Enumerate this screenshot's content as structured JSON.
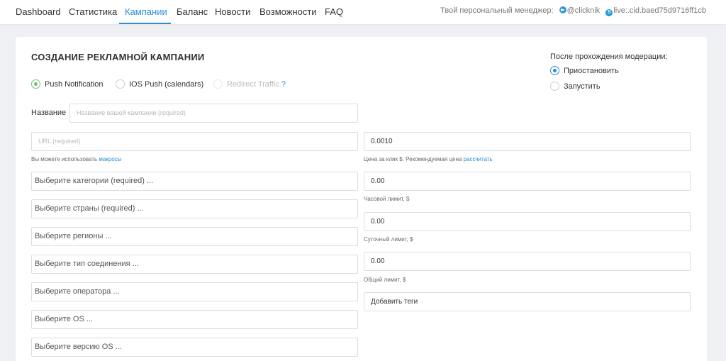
{
  "nav": {
    "items": [
      "Dashboard",
      "Статистика",
      "Кампании",
      "Баланс",
      "Новости",
      "Возможности",
      "FAQ"
    ],
    "active_index": 2,
    "manager_label": "Твой персональный менеджер:",
    "telegram": "@clicknik",
    "skype": "live:.cid.baed75d9716ff1cb"
  },
  "form": {
    "title": "СОЗДАНИЕ РЕКЛАМНОЙ КАМПАНИИ",
    "types": [
      {
        "label": "Push Notification",
        "checked": true,
        "disabled": false
      },
      {
        "label": "IOS Push (calendars)",
        "checked": false,
        "disabled": false
      },
      {
        "label": "Redirect Traffic",
        "checked": false,
        "disabled": true,
        "suffix": "?"
      }
    ],
    "moderation": {
      "title": "После прохождения модерации:",
      "options": [
        {
          "label": "Приостановить",
          "checked": true
        },
        {
          "label": "Запустить",
          "checked": false
        }
      ]
    },
    "name_label": "Название",
    "name_placeholder": "Название вашей кампании (required)",
    "url_placeholder": "URL  (required)",
    "url_help": "Вы можете использовать",
    "url_help_link": "макросы",
    "selects": [
      "Выберите категории (required) ...",
      "Выберите страны (required) ...",
      "Выберите регионы ...",
      "Выберите тип соединения ...",
      "Выберите оператора ...",
      "Выберите OS ...",
      "Выберите версию OS ..."
    ],
    "price": {
      "value": "0.0010",
      "help": "Цена за клик $. Рекомендуемая цена",
      "help_link": "рассчитать"
    },
    "hourly": {
      "value": "0.00",
      "help": "Часовой лимит, $"
    },
    "daily": {
      "value": "0.00",
      "help": "Суточный лимит, $"
    },
    "total": {
      "value": "0.00",
      "help": "Общий лимит, $"
    },
    "tags_label": "Добавить теги"
  }
}
